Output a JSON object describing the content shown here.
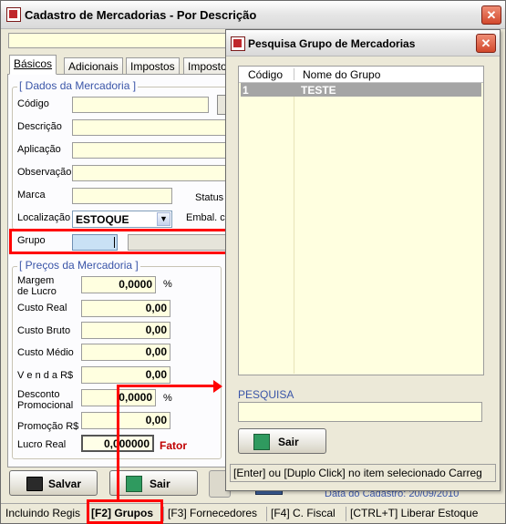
{
  "main_window": {
    "title": "Cadastro de Mercadorias - Por Descrição",
    "tabs": [
      "Básicos",
      "Adicionais",
      "Impostos",
      "Imposto"
    ],
    "group_dados": "[ Dados da Mercadoria ]",
    "labels": {
      "codigo": "Código",
      "descricao": "Descrição",
      "aplicacao": "Aplicação",
      "observacao": "Observação",
      "marca": "Marca",
      "status": "Status",
      "localizacao": "Localização",
      "embal": "Embal. co",
      "grupo": "Grupo"
    },
    "localizacao_value": "ESTOQUE",
    "group_precos": "[ Preços da Mercadoria ]",
    "prices": {
      "margem_label": "Margem\nde Lucro",
      "margem_value": "0,0000",
      "margem_unit": "%",
      "custo_real_label": "Custo Real",
      "custo_real_value": "0,00",
      "custo_bruto_label": "Custo Bruto",
      "custo_bruto_value": "0,00",
      "custo_medio_label": "Custo Médio",
      "custo_medio_value": "0,00",
      "venda_label": "V e n d a R$",
      "venda_value": "0,00",
      "desconto_label": "Desconto\nPromocional",
      "desconto_value": "0,0000",
      "desconto_unit": "%",
      "promocao_label": "Promoção R$",
      "promocao_value": "0,00",
      "lucro_label": "Lucro Real",
      "lucro_value": "0,000000",
      "fator_label": "Fator"
    },
    "buttons": {
      "salvar": "Salvar",
      "sair": "Sair"
    },
    "data_cadastro": "Data do Cadastro: 20/09/2010",
    "status_bar": [
      "Incluindo Regis",
      "[F2] Grupos",
      "[F3] Fornecedores",
      "[F4] C. Fiscal",
      "[CTRL+T] Liberar Estoque"
    ]
  },
  "dialog": {
    "title": "Pesquisa Grupo de Mercadorias",
    "columns": [
      "Código",
      "Nome do Grupo"
    ],
    "rows": [
      {
        "codigo": "1",
        "nome": "TESTE"
      }
    ],
    "search_label": "PESQUISA",
    "search_value": "",
    "sair_button": "Sair",
    "hint": "[Enter] ou [Duplo Click] no item selecionado Carreg"
  },
  "colors": {
    "field_bg": "#ffffe0",
    "highlight": "#ff0000",
    "group_title": "#3a55a8",
    "selected_row": "#a5a5a5"
  }
}
